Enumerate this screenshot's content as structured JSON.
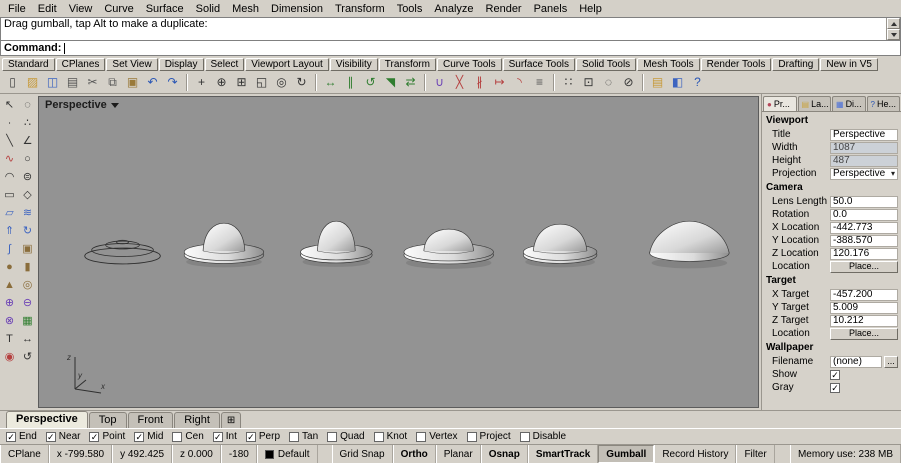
{
  "menu": {
    "items": [
      "File",
      "Edit",
      "View",
      "Curve",
      "Surface",
      "Solid",
      "Mesh",
      "Dimension",
      "Transform",
      "Tools",
      "Analyze",
      "Render",
      "Panels",
      "Help"
    ]
  },
  "command": {
    "history_line": "Drag gumball, tap Alt to make a duplicate:",
    "prompt_label": "Command:"
  },
  "toolbar": {
    "tabs": [
      "Standard",
      "CPlanes",
      "Set View",
      "Display",
      "Select",
      "Viewport Layout",
      "Visibility",
      "Transform",
      "Curve Tools",
      "Surface Tools",
      "Solid Tools",
      "Mesh Tools",
      "Render Tools",
      "Drafting",
      "New in V5"
    ],
    "icons": [
      {
        "name": "new-file",
        "glyph": "▯",
        "color": "#444444"
      },
      {
        "name": "open-file",
        "glyph": "▨",
        "color": "#c79a3a"
      },
      {
        "name": "save-file",
        "glyph": "◫",
        "color": "#3d64c0"
      },
      {
        "name": "print",
        "glyph": "▤",
        "color": "#555555"
      },
      {
        "name": "cut",
        "glyph": "✂",
        "color": "#555555"
      },
      {
        "name": "copy",
        "glyph": "⧉",
        "color": "#555555"
      },
      {
        "name": "paste",
        "glyph": "▣",
        "color": "#9a7a3a"
      },
      {
        "name": "undo",
        "glyph": "↶",
        "color": "#2a56b5"
      },
      {
        "name": "redo",
        "glyph": "↷",
        "color": "#2a56b5"
      },
      {
        "sep": true
      },
      {
        "name": "pan",
        "glyph": "+",
        "color": "#333333"
      },
      {
        "name": "zoom-dynamic",
        "glyph": "⊕",
        "color": "#333333"
      },
      {
        "name": "zoom-window",
        "glyph": "⊞",
        "color": "#333333"
      },
      {
        "name": "zoom-extents",
        "glyph": "◱",
        "color": "#333333"
      },
      {
        "name": "zoom-selected",
        "glyph": "◎",
        "color": "#333333"
      },
      {
        "name": "rotate-view",
        "glyph": "↻",
        "color": "#333333"
      },
      {
        "sep": true
      },
      {
        "name": "move",
        "glyph": "↔",
        "color": "#2f7d2f"
      },
      {
        "name": "copy-object",
        "glyph": "∥",
        "color": "#2f7d2f"
      },
      {
        "name": "rotate",
        "glyph": "↺",
        "color": "#2f7d2f"
      },
      {
        "name": "scale",
        "glyph": "◥",
        "color": "#2f7d2f"
      },
      {
        "name": "mirror",
        "glyph": "⇄",
        "color": "#2f7d2f"
      },
      {
        "sep": true
      },
      {
        "name": "join",
        "glyph": "∪",
        "color": "#6a3fb5"
      },
      {
        "name": "trim",
        "glyph": "╳",
        "color": "#b53f3f"
      },
      {
        "name": "split",
        "glyph": "∦",
        "color": "#b53f3f"
      },
      {
        "name": "extend",
        "glyph": "↦",
        "color": "#b53f3f"
      },
      {
        "name": "fillet",
        "glyph": "◝",
        "color": "#b53f3f"
      },
      {
        "name": "offset",
        "glyph": "≡",
        "color": "#555555"
      },
      {
        "sep": true
      },
      {
        "name": "array",
        "glyph": "∷",
        "color": "#333333"
      },
      {
        "name": "group",
        "glyph": "⊡",
        "color": "#333333"
      },
      {
        "name": "hide",
        "glyph": "◌",
        "color": "#333333"
      },
      {
        "name": "lock",
        "glyph": "⊘",
        "color": "#333333"
      },
      {
        "sep": true
      },
      {
        "name": "layers",
        "glyph": "▤",
        "color": "#c79a3a"
      },
      {
        "name": "properties",
        "glyph": "◧",
        "color": "#3d64c0"
      },
      {
        "name": "help",
        "glyph": "?",
        "color": "#2a56b5"
      }
    ]
  },
  "left_toolbar": {
    "icons": [
      {
        "name": "select",
        "glyph": "↖",
        "color": "#333333"
      },
      {
        "name": "lasso",
        "glyph": "◌",
        "color": "#333333"
      },
      {
        "name": "point",
        "glyph": "∙",
        "color": "#333333"
      },
      {
        "name": "point-cloud",
        "glyph": "∴",
        "color": "#333333"
      },
      {
        "name": "line",
        "glyph": "╲",
        "color": "#333333"
      },
      {
        "name": "polyline",
        "glyph": "∠",
        "color": "#333333"
      },
      {
        "name": "curve",
        "glyph": "∿",
        "color": "#b53f3f"
      },
      {
        "name": "circle",
        "glyph": "○",
        "color": "#333333"
      },
      {
        "name": "arc",
        "glyph": "◠",
        "color": "#333333"
      },
      {
        "name": "ellipse",
        "glyph": "⊜",
        "color": "#333333"
      },
      {
        "name": "rectangle",
        "glyph": "▭",
        "color": "#333333"
      },
      {
        "name": "polygon",
        "glyph": "◇",
        "color": "#333333"
      },
      {
        "name": "surface",
        "glyph": "▱",
        "color": "#3d64c0"
      },
      {
        "name": "loft",
        "glyph": "≋",
        "color": "#3d64c0"
      },
      {
        "name": "extrude",
        "glyph": "⇑",
        "color": "#3d64c0"
      },
      {
        "name": "revolve",
        "glyph": "↻",
        "color": "#3d64c0"
      },
      {
        "name": "sweep",
        "glyph": "∫",
        "color": "#3d64c0"
      },
      {
        "name": "box",
        "glyph": "▣",
        "color": "#8a6d3b"
      },
      {
        "name": "sphere",
        "glyph": "●",
        "color": "#8a6d3b"
      },
      {
        "name": "cylinder",
        "glyph": "▮",
        "color": "#8a6d3b"
      },
      {
        "name": "cone",
        "glyph": "▲",
        "color": "#8a6d3b"
      },
      {
        "name": "torus",
        "glyph": "◎",
        "color": "#8a6d3b"
      },
      {
        "name": "boolean-union",
        "glyph": "⊕",
        "color": "#6a3fb5"
      },
      {
        "name": "boolean-difference",
        "glyph": "⊖",
        "color": "#6a3fb5"
      },
      {
        "name": "boolean-intersection",
        "glyph": "⊗",
        "color": "#6a3fb5"
      },
      {
        "name": "mesh",
        "glyph": "▦",
        "color": "#2f7d2f"
      },
      {
        "name": "text",
        "glyph": "T",
        "color": "#333333"
      },
      {
        "name": "dimension",
        "glyph": "↔",
        "color": "#333333"
      },
      {
        "name": "gumball",
        "glyph": "◉",
        "color": "#b53f3f"
      },
      {
        "name": "rotate-tool",
        "glyph": "↺",
        "color": "#333333"
      }
    ]
  },
  "viewport": {
    "label": "Perspective",
    "axis_labels": {
      "x": "x",
      "y": "y",
      "z": "z"
    }
  },
  "panel": {
    "tabs": [
      {
        "label": "Pr...",
        "icon": "properties-tab-icon",
        "glyph": "●",
        "color": "#b5485a",
        "active": true
      },
      {
        "label": "La...",
        "icon": "layers-tab-icon",
        "glyph": "▤",
        "color": "#c9a43f",
        "active": false
      },
      {
        "label": "Di...",
        "icon": "display-tab-icon",
        "glyph": "▦",
        "color": "#4a6fd8",
        "active": false
      },
      {
        "label": "He...",
        "icon": "help-tab-icon",
        "glyph": "?",
        "color": "#2a56b5",
        "active": false
      }
    ],
    "sections": [
      {
        "title": "Viewport",
        "rows": [
          {
            "label": "Title",
            "value": "Perspective",
            "type": "plain"
          },
          {
            "label": "Width",
            "value": "1087",
            "type": "dim"
          },
          {
            "label": "Height",
            "value": "487",
            "type": "dim"
          },
          {
            "label": "Projection",
            "value": "Perspective",
            "type": "select"
          }
        ]
      },
      {
        "title": "Camera",
        "rows": [
          {
            "label": "Lens Length",
            "value": "50.0",
            "type": "plain"
          },
          {
            "label": "Rotation",
            "value": "0.0",
            "type": "plain"
          },
          {
            "label": "X Location",
            "value": "-442.773",
            "type": "plain"
          },
          {
            "label": "Y Location",
            "value": "-388.570",
            "type": "plain"
          },
          {
            "label": "Z Location",
            "value": "120.176",
            "type": "plain"
          },
          {
            "label": "Location",
            "value": "Place...",
            "type": "button"
          }
        ]
      },
      {
        "title": "Target",
        "rows": [
          {
            "label": "X Target",
            "value": "-457.200",
            "type": "plain"
          },
          {
            "label": "Y Target",
            "value": "5.009",
            "type": "plain"
          },
          {
            "label": "Z Target",
            "value": "10.212",
            "type": "plain"
          },
          {
            "label": "Location",
            "value": "Place...",
            "type": "button"
          }
        ]
      },
      {
        "title": "Wallpaper",
        "rows": [
          {
            "label": "Filename",
            "value": "(none)",
            "type": "file",
            "button": "..."
          },
          {
            "label": "Show",
            "type": "checkbox",
            "checked": true
          },
          {
            "label": "Gray",
            "type": "checkbox",
            "checked": true
          }
        ]
      }
    ]
  },
  "viewport_tabs": {
    "tabs": [
      {
        "label": "Perspective",
        "active": true
      },
      {
        "label": "Top",
        "active": false
      },
      {
        "label": "Front",
        "active": false
      },
      {
        "label": "Right",
        "active": false
      }
    ],
    "add_glyph": "⊞"
  },
  "osnap": {
    "items": [
      {
        "label": "End",
        "checked": true
      },
      {
        "label": "Near",
        "checked": true
      },
      {
        "label": "Point",
        "checked": true
      },
      {
        "label": "Mid",
        "checked": true
      },
      {
        "label": "Cen",
        "checked": false
      },
      {
        "label": "Int",
        "checked": true
      },
      {
        "label": "Perp",
        "checked": true
      },
      {
        "label": "Tan",
        "checked": false
      },
      {
        "label": "Quad",
        "checked": false
      },
      {
        "label": "Knot",
        "checked": false
      },
      {
        "label": "Vertex",
        "checked": false
      },
      {
        "label": "Project",
        "checked": false
      },
      {
        "label": "Disable",
        "checked": false
      }
    ]
  },
  "status": {
    "cplane_label": "CPlane",
    "coords": [
      {
        "name": "x-coordinate",
        "text": "x -799.580"
      },
      {
        "name": "y-coordinate",
        "text": "y 492.425"
      },
      {
        "name": "z-coordinate",
        "text": "z 0.000"
      },
      {
        "name": "angle-readout",
        "text": "-180"
      }
    ],
    "layer": {
      "name": "Default",
      "color": "#000000"
    },
    "toggles": [
      {
        "label": "Grid Snap",
        "bold": false,
        "pressed": false
      },
      {
        "label": "Ortho",
        "bold": true,
        "pressed": false
      },
      {
        "label": "Planar",
        "bold": false,
        "pressed": false
      },
      {
        "label": "Osnap",
        "bold": true,
        "pressed": false
      },
      {
        "label": "SmartTrack",
        "bold": true,
        "pressed": false
      },
      {
        "label": "Gumball",
        "bold": true,
        "pressed": true
      },
      {
        "label": "Record History",
        "bold": false,
        "pressed": false
      },
      {
        "label": "Filter",
        "bold": false,
        "pressed": false
      }
    ],
    "memory": "Memory use: 238 MB"
  }
}
